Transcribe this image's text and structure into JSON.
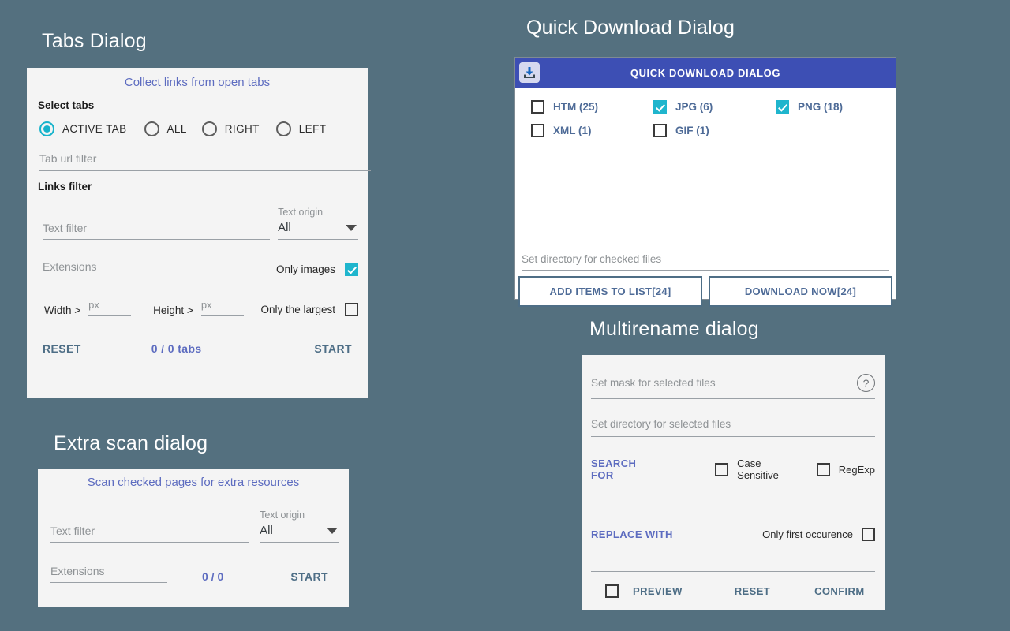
{
  "colors": {
    "page_background": "#54707F",
    "dialog_background": "#f4f4f4",
    "accent_teal": "#1fb5cd",
    "accent_indigo": "#5d6cc0",
    "header_blue": "#3d4fb4",
    "flat_button": "#4e6e86"
  },
  "tabs_dialog": {
    "section_title": "Tabs Dialog",
    "heading": "Collect links from open tabs",
    "select_tabs_label": "Select tabs",
    "radios": [
      {
        "label": "ACTIVE TAB",
        "selected": true
      },
      {
        "label": "ALL",
        "selected": false
      },
      {
        "label": "RIGHT",
        "selected": false
      },
      {
        "label": "LEFT",
        "selected": false
      }
    ],
    "tab_url_filter": {
      "placeholder": "Tab url filter",
      "value": ""
    },
    "links_filter_label": "Links filter",
    "text_filter": {
      "placeholder": "Text filter",
      "value": ""
    },
    "text_origin": {
      "label": "Text origin",
      "value": "All",
      "options": [
        "All"
      ]
    },
    "extensions": {
      "placeholder": "Extensions",
      "value": ""
    },
    "only_images": {
      "label": "Only images",
      "checked": true
    },
    "width_label": "Width >",
    "width_input": {
      "placeholder": "px",
      "value": ""
    },
    "height_label": "Height >",
    "height_input": {
      "placeholder": "px",
      "value": ""
    },
    "only_largest": {
      "label": "Only the largest",
      "checked": false
    },
    "reset_label": "RESET",
    "count_label": "0 / 0 tabs",
    "start_label": "START"
  },
  "extra_scan_dialog": {
    "section_title": "Extra scan dialog",
    "heading": "Scan checked pages for extra resources",
    "text_filter": {
      "placeholder": "Text filter",
      "value": ""
    },
    "text_origin": {
      "label": "Text origin",
      "value": "All",
      "options": [
        "All"
      ]
    },
    "extensions": {
      "placeholder": "Extensions",
      "value": ""
    },
    "count_label": "0 / 0",
    "start_label": "START"
  },
  "quick_download_dialog": {
    "section_title": "Quick Download Dialog",
    "header_title": "QUICK DOWNLOAD DIALOG",
    "header_icon": "download-icon",
    "file_types": [
      {
        "label": "HTM (25)",
        "checked": false
      },
      {
        "label": "JPG (6)",
        "checked": true
      },
      {
        "label": "PNG (18)",
        "checked": true
      },
      {
        "label": "XML (1)",
        "checked": false
      },
      {
        "label": "GIF (1)",
        "checked": false
      }
    ],
    "directory_input": {
      "placeholder": "Set directory for checked files",
      "value": ""
    },
    "add_items_label": "ADD ITEMS TO LIST[24]",
    "download_now_label": "DOWNLOAD NOW[24]"
  },
  "multirename_dialog": {
    "section_title": "Multirename dialog",
    "mask_input": {
      "placeholder": "Set mask for selected files",
      "value": ""
    },
    "help_icon": "help-circle-icon",
    "directory_input": {
      "placeholder": "Set directory for selected files",
      "value": ""
    },
    "search_for_label": "SEARCH FOR",
    "case_sensitive": {
      "label": "Case Sensitive",
      "checked": false
    },
    "regexp": {
      "label": "RegExp",
      "checked": false
    },
    "replace_with_label": "REPLACE WITH",
    "only_first_occurence": {
      "label": "Only first occurence",
      "checked": false
    },
    "preview": {
      "label": "PREVIEW",
      "checked": false
    },
    "reset_label": "RESET",
    "confirm_label": "CONFIRM"
  }
}
